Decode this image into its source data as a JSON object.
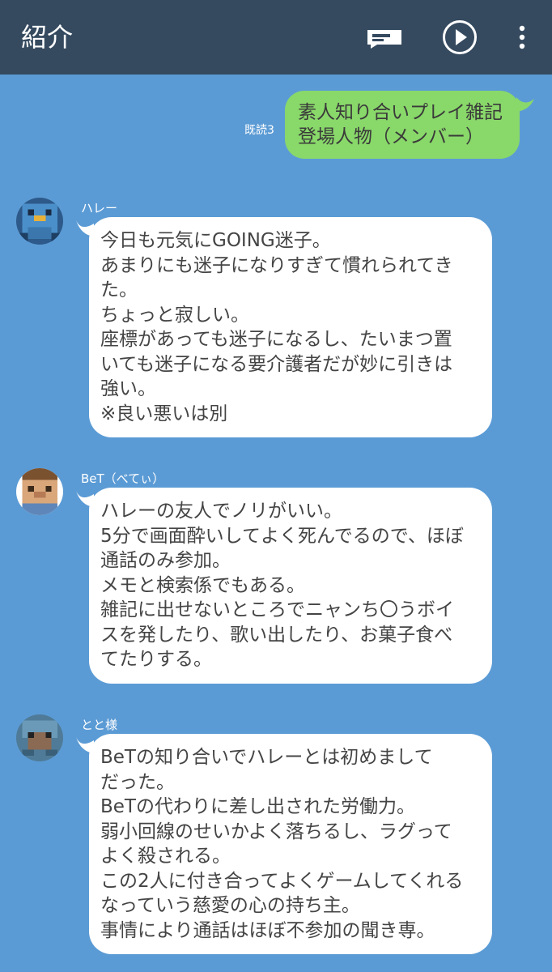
{
  "header": {
    "title": "紹介",
    "icons": [
      "keyboard-icon",
      "play-icon",
      "more-icon"
    ]
  },
  "sent_message": {
    "read_status": "既読3",
    "lines": [
      "素人知り合いプレイ雑記",
      "登場人物（メンバー）"
    ]
  },
  "messages": [
    {
      "sender": "ハレー",
      "lines": [
        "今日も元気にGOING迷子。",
        "あまりにも迷子になりすぎて慣れられてき",
        "た。",
        "ちょっと寂しい。",
        "座標があっても迷子になるし、たいまつ置",
        "いても迷子になる要介護者だが妙に引きは",
        "強い。",
        "※良い悪いは別"
      ]
    },
    {
      "sender": "BeT（べてぃ）",
      "lines": [
        "ハレーの友人でノリがいい。",
        "5分で画面酔いしてよく死んでるので、ほぼ",
        "通話のみ参加。",
        "メモと検索係でもある。",
        "雑記に出せないところでニャンち〇うボイ",
        "スを発したり、歌い出したり、お菓子食べ",
        "てたりする。"
      ]
    },
    {
      "sender": "とと様",
      "lines": [
        "BeTの知り合いでハレーとは初めまして",
        "だった。",
        "BeTの代わりに差し出された労働力。",
        "弱小回線のせいかよく落ちるし、ラグって",
        "よく殺される。",
        "この2人に付き合ってよくゲームしてくれる",
        "なっていう慈愛の心の持ち主。",
        "事情により通話はほぼ不参加の聞き専。"
      ]
    }
  ],
  "colors": {
    "header_bg": "#354a5f",
    "chat_bg": "#5b9bd5",
    "sent_bubble": "#89d86a",
    "received_bubble": "#ffffff"
  }
}
